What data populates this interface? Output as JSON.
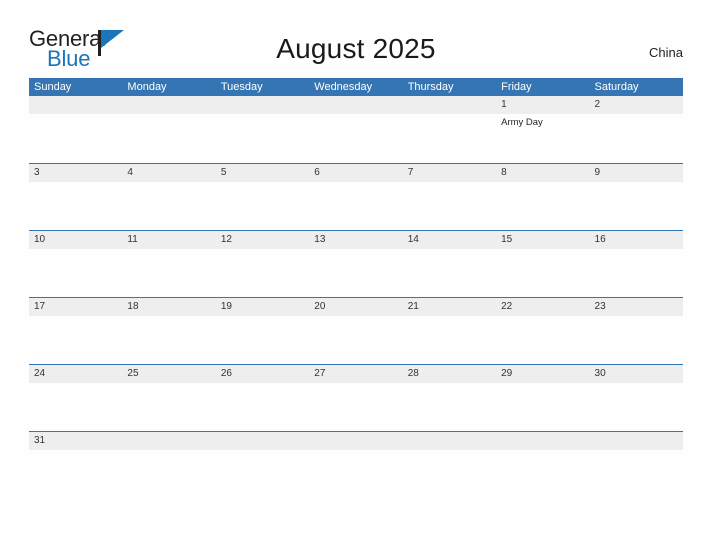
{
  "branding": {
    "name_part1": "General",
    "name_part2": "Blue",
    "flag_icon": "flag-triangle-icon",
    "accent_color": "#1b75bb",
    "dark_color": "#231f20"
  },
  "header": {
    "title": "August 2025",
    "region": "China"
  },
  "colors": {
    "header_blue": "#3575b3",
    "band_gray": "#eeeeee",
    "rule_blue": "#3575b3",
    "page_background": "#fefefe",
    "text_dark": "#231f20"
  },
  "weekdays": [
    "Sunday",
    "Monday",
    "Tuesday",
    "Wednesday",
    "Thursday",
    "Friday",
    "Saturday"
  ],
  "weeks": [
    {
      "days": [
        {
          "date": "",
          "events": []
        },
        {
          "date": "",
          "events": []
        },
        {
          "date": "",
          "events": []
        },
        {
          "date": "",
          "events": []
        },
        {
          "date": "",
          "events": []
        },
        {
          "date": "1",
          "events": [
            "Army Day"
          ]
        },
        {
          "date": "2",
          "events": []
        }
      ]
    },
    {
      "days": [
        {
          "date": "3",
          "events": []
        },
        {
          "date": "4",
          "events": []
        },
        {
          "date": "5",
          "events": []
        },
        {
          "date": "6",
          "events": []
        },
        {
          "date": "7",
          "events": []
        },
        {
          "date": "8",
          "events": []
        },
        {
          "date": "9",
          "events": []
        }
      ]
    },
    {
      "days": [
        {
          "date": "10",
          "events": []
        },
        {
          "date": "11",
          "events": []
        },
        {
          "date": "12",
          "events": []
        },
        {
          "date": "13",
          "events": []
        },
        {
          "date": "14",
          "events": []
        },
        {
          "date": "15",
          "events": []
        },
        {
          "date": "16",
          "events": []
        }
      ]
    },
    {
      "days": [
        {
          "date": "17",
          "events": []
        },
        {
          "date": "18",
          "events": []
        },
        {
          "date": "19",
          "events": []
        },
        {
          "date": "20",
          "events": []
        },
        {
          "date": "21",
          "events": []
        },
        {
          "date": "22",
          "events": []
        },
        {
          "date": "23",
          "events": []
        }
      ]
    },
    {
      "days": [
        {
          "date": "24",
          "events": []
        },
        {
          "date": "25",
          "events": []
        },
        {
          "date": "26",
          "events": []
        },
        {
          "date": "27",
          "events": []
        },
        {
          "date": "28",
          "events": []
        },
        {
          "date": "29",
          "events": []
        },
        {
          "date": "30",
          "events": []
        }
      ]
    },
    {
      "days": [
        {
          "date": "31",
          "events": []
        },
        {
          "date": "",
          "events": []
        },
        {
          "date": "",
          "events": []
        },
        {
          "date": "",
          "events": []
        },
        {
          "date": "",
          "events": []
        },
        {
          "date": "",
          "events": []
        },
        {
          "date": "",
          "events": []
        }
      ]
    }
  ]
}
